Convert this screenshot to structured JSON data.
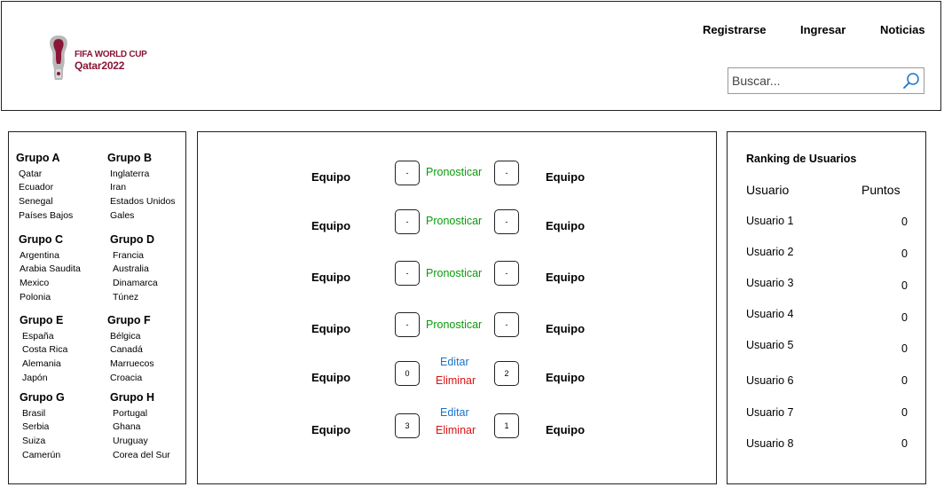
{
  "header": {
    "logo": {
      "line1": "FIFA WORLD CUP",
      "line2": "Qatar2022",
      "icon": "world-cup-trophy-icon"
    },
    "nav": [
      "Registrarse",
      "Ingresar",
      "Noticias"
    ],
    "search": {
      "placeholder": "Buscar...",
      "value": ""
    }
  },
  "groups": [
    {
      "name": "Grupo A",
      "teams": [
        "Qatar",
        "Ecuador",
        "Senegal",
        "Países Bajos"
      ]
    },
    {
      "name": "Grupo B",
      "teams": [
        "Inglaterra",
        "Iran",
        "Estados Unidos",
        "Gales"
      ]
    },
    {
      "name": "Grupo C",
      "teams": [
        "Argentina",
        "Arabia Saudita",
        "Mexico",
        "Polonia"
      ]
    },
    {
      "name": "Grupo D",
      "teams": [
        "Francia",
        "Australia",
        "Dinamarca",
        "Túnez"
      ]
    },
    {
      "name": "Grupo E",
      "teams": [
        "España",
        "Costa Rica",
        "Alemania",
        "Japón"
      ]
    },
    {
      "name": "Grupo F",
      "teams": [
        "Bélgica",
        "Canadá",
        "Marruecos",
        "Croacia"
      ]
    },
    {
      "name": "Grupo G",
      "teams": [
        "Brasil",
        "Serbia",
        "Suiza",
        "Camerún"
      ]
    },
    {
      "name": "Grupo H",
      "teams": [
        "Portugal",
        "Ghana",
        "Uruguay",
        "Corea del Sur"
      ]
    }
  ],
  "matches": [
    {
      "home": "Equipo",
      "away": "Equipo",
      "home_score": "-",
      "away_score": "-",
      "actions": [
        "Pronosticar"
      ]
    },
    {
      "home": "Equipo",
      "away": "Equipo",
      "home_score": "-",
      "away_score": "-",
      "actions": [
        "Pronosticar"
      ]
    },
    {
      "home": "Equipo",
      "away": "Equipo",
      "home_score": "-",
      "away_score": "-",
      "actions": [
        "Pronosticar"
      ]
    },
    {
      "home": "Equipo",
      "away": "Equipo",
      "home_score": "-",
      "away_score": "-",
      "actions": [
        "Pronosticar"
      ]
    },
    {
      "home": "Equipo",
      "away": "Equipo",
      "home_score": "0",
      "away_score": "2",
      "actions": [
        "Editar",
        "Eliminar"
      ]
    },
    {
      "home": "Equipo",
      "away": "Equipo",
      "home_score": "3",
      "away_score": "1",
      "actions": [
        "Editar",
        "Eliminar"
      ]
    }
  ],
  "ranking": {
    "title": "Ranking de Usuarios",
    "col_user": "Usuario",
    "col_points": "Puntos",
    "rows": [
      {
        "user": "Usuario 1",
        "points": "0"
      },
      {
        "user": "Usuario 2",
        "points": "0"
      },
      {
        "user": "Usuario 3",
        "points": "0"
      },
      {
        "user": "Usuario 4",
        "points": "0"
      },
      {
        "user": "Usuario 5",
        "points": "0"
      },
      {
        "user": "Usuario 6",
        "points": "0"
      },
      {
        "user": "Usuario 7",
        "points": "0"
      },
      {
        "user": "Usuario 8",
        "points": "0"
      }
    ]
  },
  "colors": {
    "pronosticar": "#0a9a0a",
    "editar": "#1a73c9",
    "eliminar": "#dd1111",
    "logo": "#8a1538"
  }
}
